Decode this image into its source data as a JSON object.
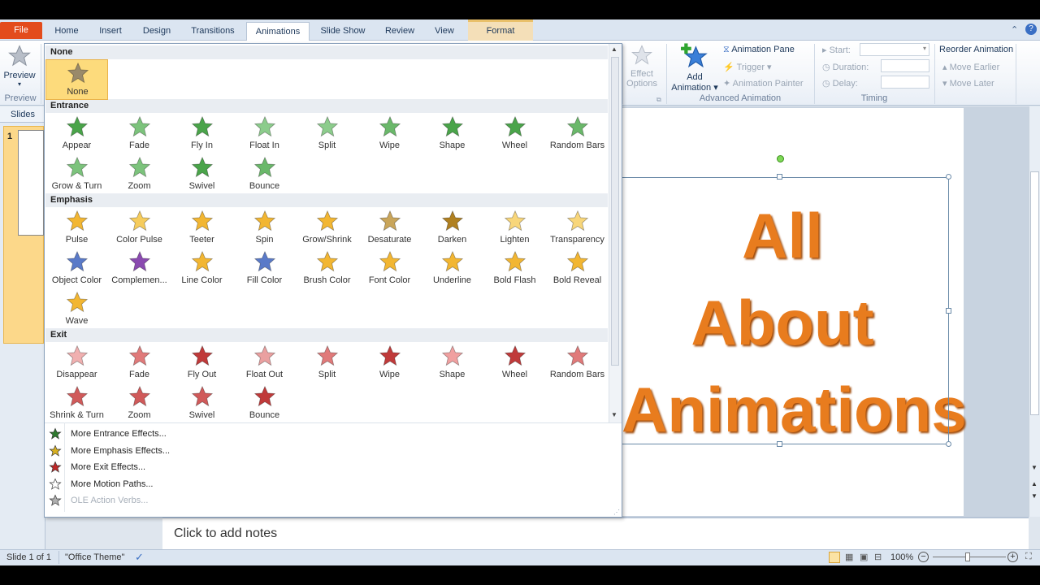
{
  "ribbon_tabs": [
    "File",
    "Home",
    "Insert",
    "Design",
    "Transitions",
    "Animations",
    "Slide Show",
    "Review",
    "View",
    "Format"
  ],
  "ribbon": {
    "preview": {
      "label": "Preview",
      "group": "Preview"
    },
    "effect_options": "Effect Options",
    "effect_options_l1": "Effect",
    "effect_options_l2": "Options",
    "add_animation_l1": "Add",
    "add_animation_l2": "Animation",
    "animation_pane": "Animation Pane",
    "trigger": "Trigger",
    "animation_painter": "Animation Painter",
    "advanced_group": "Advanced Animation",
    "start_label": "Start:",
    "duration_label": "Duration:",
    "delay_label": "Delay:",
    "timing_group": "Timing",
    "reorder_title": "Reorder Animation",
    "move_earlier": "Move Earlier",
    "move_later": "Move Later"
  },
  "left_pane": {
    "tab": "Slides",
    "slide_number": "1"
  },
  "slide": {
    "line1": "All",
    "line2": "About",
    "line3": "Animations"
  },
  "gallery": {
    "sections": {
      "none": "None",
      "entrance": "Entrance",
      "emphasis": "Emphasis",
      "exit": "Exit"
    },
    "none_items": [
      {
        "label": "None",
        "color": "#9a8a6a"
      }
    ],
    "entrance_items": [
      {
        "label": "Appear",
        "color": "#4aa44a"
      },
      {
        "label": "Fade",
        "color": "#7cc37c"
      },
      {
        "label": "Fly In",
        "color": "#4aa44a"
      },
      {
        "label": "Float In",
        "color": "#8ccc8c"
      },
      {
        "label": "Split",
        "color": "#8ccc8c"
      },
      {
        "label": "Wipe",
        "color": "#6ab86a"
      },
      {
        "label": "Shape",
        "color": "#4aa44a"
      },
      {
        "label": "Wheel",
        "color": "#4aa44a"
      },
      {
        "label": "Random Bars",
        "color": "#6ab86a"
      },
      {
        "label": "Grow & Turn",
        "color": "#7cc37c"
      },
      {
        "label": "Zoom",
        "color": "#7cc37c"
      },
      {
        "label": "Swivel",
        "color": "#4aa44a"
      },
      {
        "label": "Bounce",
        "color": "#6ab86a"
      }
    ],
    "emphasis_items": [
      {
        "label": "Pulse",
        "color": "#f2b632"
      },
      {
        "label": "Color Pulse",
        "color": "#f6cc5c"
      },
      {
        "label": "Teeter",
        "color": "#f2b632"
      },
      {
        "label": "Spin",
        "color": "#f2b632"
      },
      {
        "label": "Grow/Shrink",
        "color": "#f2b632"
      },
      {
        "label": "Desaturate",
        "color": "#c9a55a"
      },
      {
        "label": "Darken",
        "color": "#b08020"
      },
      {
        "label": "Lighten",
        "color": "#f8d67a"
      },
      {
        "label": "Transparency",
        "color": "#f8d67a"
      },
      {
        "label": "Object Color",
        "color": "#5a7ac8"
      },
      {
        "label": "Complemen...",
        "color": "#8a4ab0"
      },
      {
        "label": "Line Color",
        "color": "#f2b632"
      },
      {
        "label": "Fill Color",
        "color": "#5a7ac8"
      },
      {
        "label": "Brush Color",
        "color": "#f2b632"
      },
      {
        "label": "Font Color",
        "color": "#f2b632"
      },
      {
        "label": "Underline",
        "color": "#f2b632"
      },
      {
        "label": "Bold Flash",
        "color": "#f2b632"
      },
      {
        "label": "Bold Reveal",
        "color": "#f2b632"
      },
      {
        "label": "Wave",
        "color": "#f2b632"
      }
    ],
    "exit_items": [
      {
        "label": "Disappear",
        "color": "#f0b0b0"
      },
      {
        "label": "Fade",
        "color": "#e07a7a"
      },
      {
        "label": "Fly Out",
        "color": "#c03a3a"
      },
      {
        "label": "Float Out",
        "color": "#eaa0a0"
      },
      {
        "label": "Split",
        "color": "#e07a7a"
      },
      {
        "label": "Wipe",
        "color": "#c03a3a"
      },
      {
        "label": "Shape",
        "color": "#f0a0a0"
      },
      {
        "label": "Wheel",
        "color": "#c03a3a"
      },
      {
        "label": "Random Bars",
        "color": "#e07a7a"
      },
      {
        "label": "Shrink & Turn",
        "color": "#d05a5a"
      },
      {
        "label": "Zoom",
        "color": "#d05a5a"
      },
      {
        "label": "Swivel",
        "color": "#d05a5a"
      },
      {
        "label": "Bounce",
        "color": "#c03a3a"
      }
    ],
    "more": [
      {
        "label": "More Entrance Effects...",
        "color": "#2e7a2e"
      },
      {
        "label": "More Emphasis Effects...",
        "color": "#d8b020"
      },
      {
        "label": "More Exit Effects...",
        "color": "#c02828"
      },
      {
        "label": "More Motion Paths...",
        "color": "#ffffff"
      },
      {
        "label": "OLE Action Verbs...",
        "color": "#b0b0b0"
      }
    ]
  },
  "notes": {
    "placeholder": "Click to add notes"
  },
  "status": {
    "slide_info": "Slide 1 of 1",
    "theme": "\"Office Theme\"",
    "zoom": "100%"
  },
  "colors": {
    "file_tab": "#e34c1c",
    "title_text": "#e87c1e",
    "selected_cell": "#fddb7c"
  }
}
